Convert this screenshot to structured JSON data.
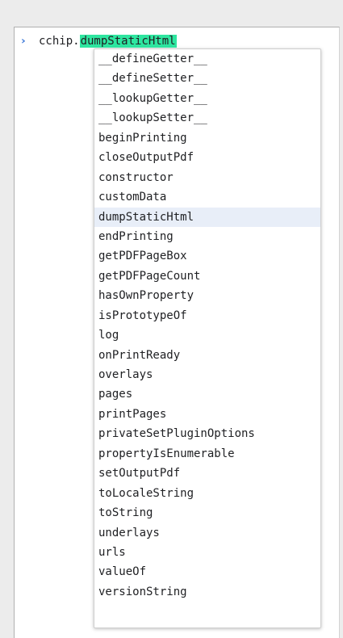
{
  "console": {
    "prompt_icon": "chevron-right-icon",
    "typed": "cchip.",
    "completion": "dumpStaticHtml",
    "completion_highlight_color": "#2ee6a0",
    "prompt_color": "#3c78d8"
  },
  "autocomplete": {
    "selected_index": 8,
    "selected_bg": "#e8eef8",
    "items": [
      "__defineGetter__",
      "__defineSetter__",
      "__lookupGetter__",
      "__lookupSetter__",
      "beginPrinting",
      "closeOutputPdf",
      "constructor",
      "customData",
      "dumpStaticHtml",
      "endPrinting",
      "getPDFPageBox",
      "getPDFPageCount",
      "hasOwnProperty",
      "isPrototypeOf",
      "log",
      "onPrintReady",
      "overlays",
      "pages",
      "printPages",
      "privateSetPluginOptions",
      "propertyIsEnumerable",
      "setOutputPdf",
      "toLocaleString",
      "toString",
      "underlays",
      "urls",
      "valueOf",
      "versionString"
    ]
  }
}
